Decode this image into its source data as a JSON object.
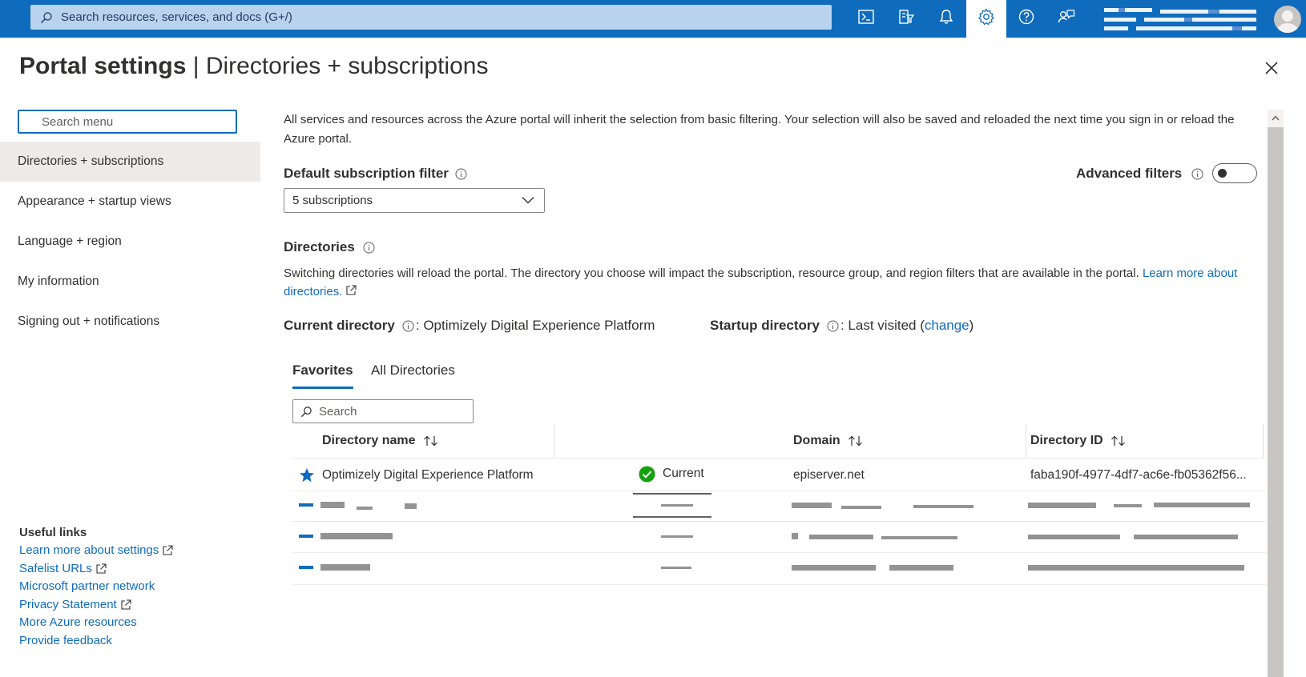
{
  "topbar": {
    "search_placeholder": "Search resources, services, and docs (G+/)",
    "buttons": [
      {
        "name": "cloud-shell",
        "icon": "terminal-icon"
      },
      {
        "name": "directory-filter",
        "icon": "filter-icon"
      },
      {
        "name": "notifications",
        "icon": "bell-icon"
      },
      {
        "name": "settings",
        "icon": "gear-icon",
        "active": true
      },
      {
        "name": "help",
        "icon": "question-icon"
      },
      {
        "name": "feedback",
        "icon": "feedback-icon"
      }
    ],
    "account_redacted": true
  },
  "page": {
    "title_bold": "Portal settings",
    "title_rest": " | Directories + subscriptions"
  },
  "menu": {
    "search_placeholder": "Search menu",
    "items": [
      {
        "label": "Directories + subscriptions",
        "selected": true
      },
      {
        "label": "Appearance + startup views"
      },
      {
        "label": "Language + region"
      },
      {
        "label": "My information"
      },
      {
        "label": "Signing out + notifications"
      }
    ]
  },
  "useful_links": {
    "title": "Useful links",
    "links": [
      {
        "label": "Learn more about settings",
        "external": true
      },
      {
        "label": "Safelist URLs",
        "external": true
      },
      {
        "label": "Microsoft partner network",
        "external": false
      },
      {
        "label": "Privacy Statement",
        "external": true
      },
      {
        "label": "More Azure resources",
        "external": false
      },
      {
        "label": "Provide feedback",
        "external": false
      }
    ]
  },
  "main": {
    "intro": "All services and resources across the Azure portal will inherit the selection from basic filtering. Your selection will also be saved and reloaded the next time you sign in or reload the Azure portal.",
    "subscription_filter_label": "Default subscription filter",
    "subscription_filter_value": "5 subscriptions",
    "advanced_filters_label": "Advanced filters",
    "advanced_filters_on": false,
    "directories_label": "Directories",
    "directories_desc": "Switching directories will reload the portal. The directory you choose will impact the subscription, resource group, and region filters that are available in the portal. ",
    "directories_link": "Learn more about directories.",
    "current_directory_label": "Current directory",
    "current_directory_value": ": Optimizely Digital Experience Platform",
    "startup_directory_label": "Startup directory",
    "startup_directory_value": ": Last visited (",
    "startup_change_link": "change",
    "startup_close_paren": ")",
    "tabs": [
      {
        "label": "Favorites",
        "active": true
      },
      {
        "label": "All Directories",
        "active": false
      }
    ],
    "table_search_placeholder": "Search",
    "columns": {
      "name": "Directory name",
      "domain": "Domain",
      "id": "Directory ID"
    },
    "rows": [
      {
        "name": "Optimizely Digital Experience Platform",
        "status": "Current",
        "domain": "episerver.net",
        "id": "faba190f-4977-4df7-ac6e-fb05362f56..."
      }
    ],
    "redacted_row_count": 3
  },
  "colors": {
    "accent": "#0f6cbd",
    "current_status": "#13a10e"
  }
}
